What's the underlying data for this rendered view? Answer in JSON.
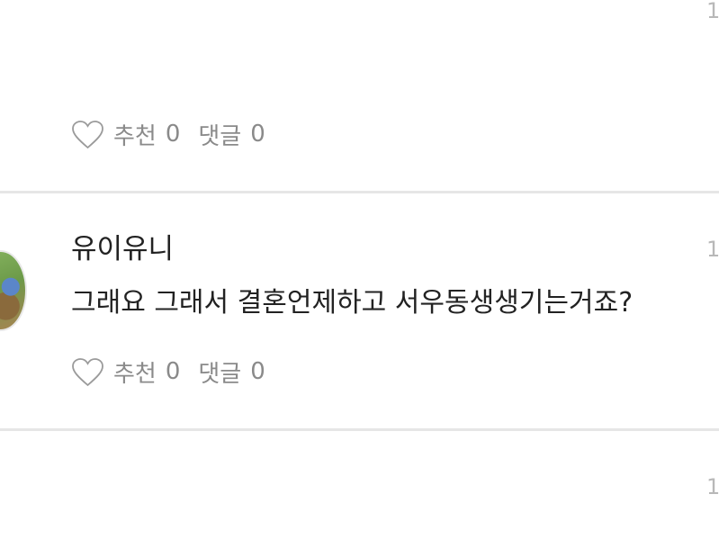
{
  "comments": [
    {
      "author": "",
      "time": "1",
      "text": "",
      "actions": {
        "like_label": "추천",
        "like_count": "0",
        "reply_label": "댓글",
        "reply_count": "0"
      }
    },
    {
      "author": "유이유니",
      "time": "1",
      "text": "그래요 그래서 결혼언제하고 서우동생생기는거죠?",
      "actions": {
        "like_label": "추천",
        "like_count": "0",
        "reply_label": "댓글",
        "reply_count": "0"
      }
    },
    {
      "author": "",
      "time": "1",
      "text": "",
      "actions": {
        "like_label": "",
        "like_count": "",
        "reply_label": "",
        "reply_count": ""
      }
    }
  ]
}
